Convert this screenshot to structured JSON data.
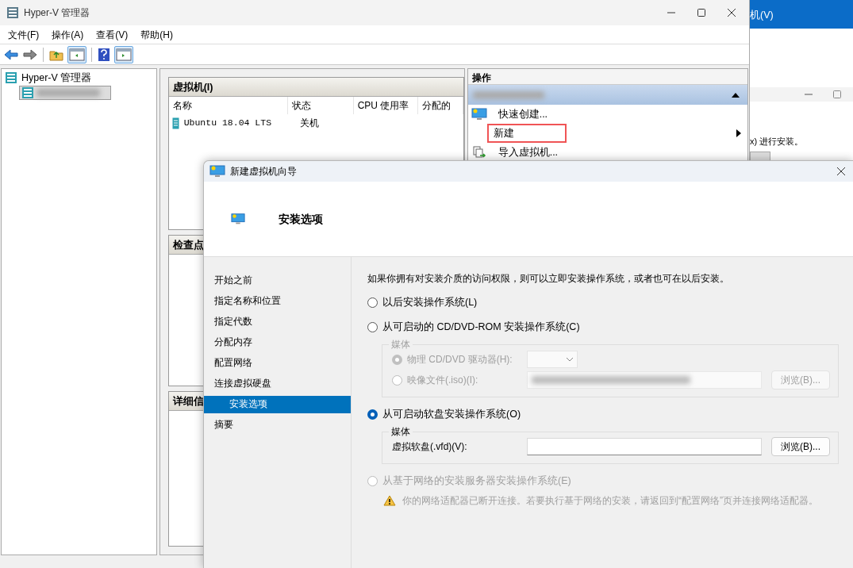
{
  "back_window": {
    "title_fragment": "机(V)",
    "text_fragment": "x) 进行安装。"
  },
  "main_window": {
    "title": "Hyper-V 管理器",
    "menu": [
      "文件(F)",
      "操作(A)",
      "查看(V)",
      "帮助(H)"
    ],
    "tree": {
      "root": "Hyper-V 管理器",
      "host_selected": true
    },
    "vm_panel": {
      "title": "虚拟机(I)",
      "columns": [
        "名称",
        "状态",
        "CPU 使用率",
        "分配的"
      ],
      "rows": [
        {
          "name": "Ubuntu 18.04 LTS",
          "state": "关机"
        }
      ]
    },
    "checkpoint_panel": {
      "title": "检查点"
    },
    "details_panel": {
      "title": "详细信"
    },
    "actions": {
      "title": "操作",
      "items": [
        {
          "label": "快速创建...",
          "kind": "quick",
          "highlighted": false
        },
        {
          "label": "新建",
          "kind": "submenu",
          "highlighted": true
        },
        {
          "label": "导入虚拟机...",
          "kind": "import",
          "highlighted": false
        }
      ]
    }
  },
  "wizard": {
    "title": "新建虚拟机向导",
    "heading": "安装选项",
    "steps": [
      {
        "label": "开始之前",
        "selected": false
      },
      {
        "label": "指定名称和位置",
        "selected": false
      },
      {
        "label": "指定代数",
        "selected": false
      },
      {
        "label": "分配内存",
        "selected": false
      },
      {
        "label": "配置网络",
        "selected": false
      },
      {
        "label": "连接虚拟硬盘",
        "selected": false
      },
      {
        "label": "安装选项",
        "selected": true
      },
      {
        "label": "摘要",
        "selected": false
      }
    ],
    "intro": "如果你拥有对安装介质的访问权限，则可以立即安装操作系统，或者也可在以后安装。",
    "options": [
      {
        "label": "以后安装操作系统(L)",
        "selected": false,
        "disabled": false
      },
      {
        "label": "从可启动的 CD/DVD-ROM 安装操作系统(C)",
        "selected": false,
        "disabled": false,
        "media": {
          "legend": "媒体",
          "disabled": true,
          "rows": [
            {
              "kind": "drive",
              "label": "物理 CD/DVD 驱动器(H):",
              "selected": true
            },
            {
              "kind": "image",
              "label": "映像文件(.iso)(I):",
              "selected": false,
              "button": "浏览(B)..."
            }
          ]
        }
      },
      {
        "label": "从可启动软盘安装操作系统(O)",
        "selected": true,
        "disabled": false,
        "media": {
          "legend": "媒体",
          "disabled": false,
          "rows": [
            {
              "kind": "field",
              "label": "虚拟软盘(.vfd)(V):",
              "button": "浏览(B)..."
            }
          ]
        }
      },
      {
        "label": "从基于网络的安装服务器安装操作系统(E)",
        "selected": false,
        "disabled": true,
        "warning": "你的网络适配器已断开连接。若要执行基于网络的安装，请返回到“配置网络”页并连接网络适配器。"
      }
    ]
  }
}
